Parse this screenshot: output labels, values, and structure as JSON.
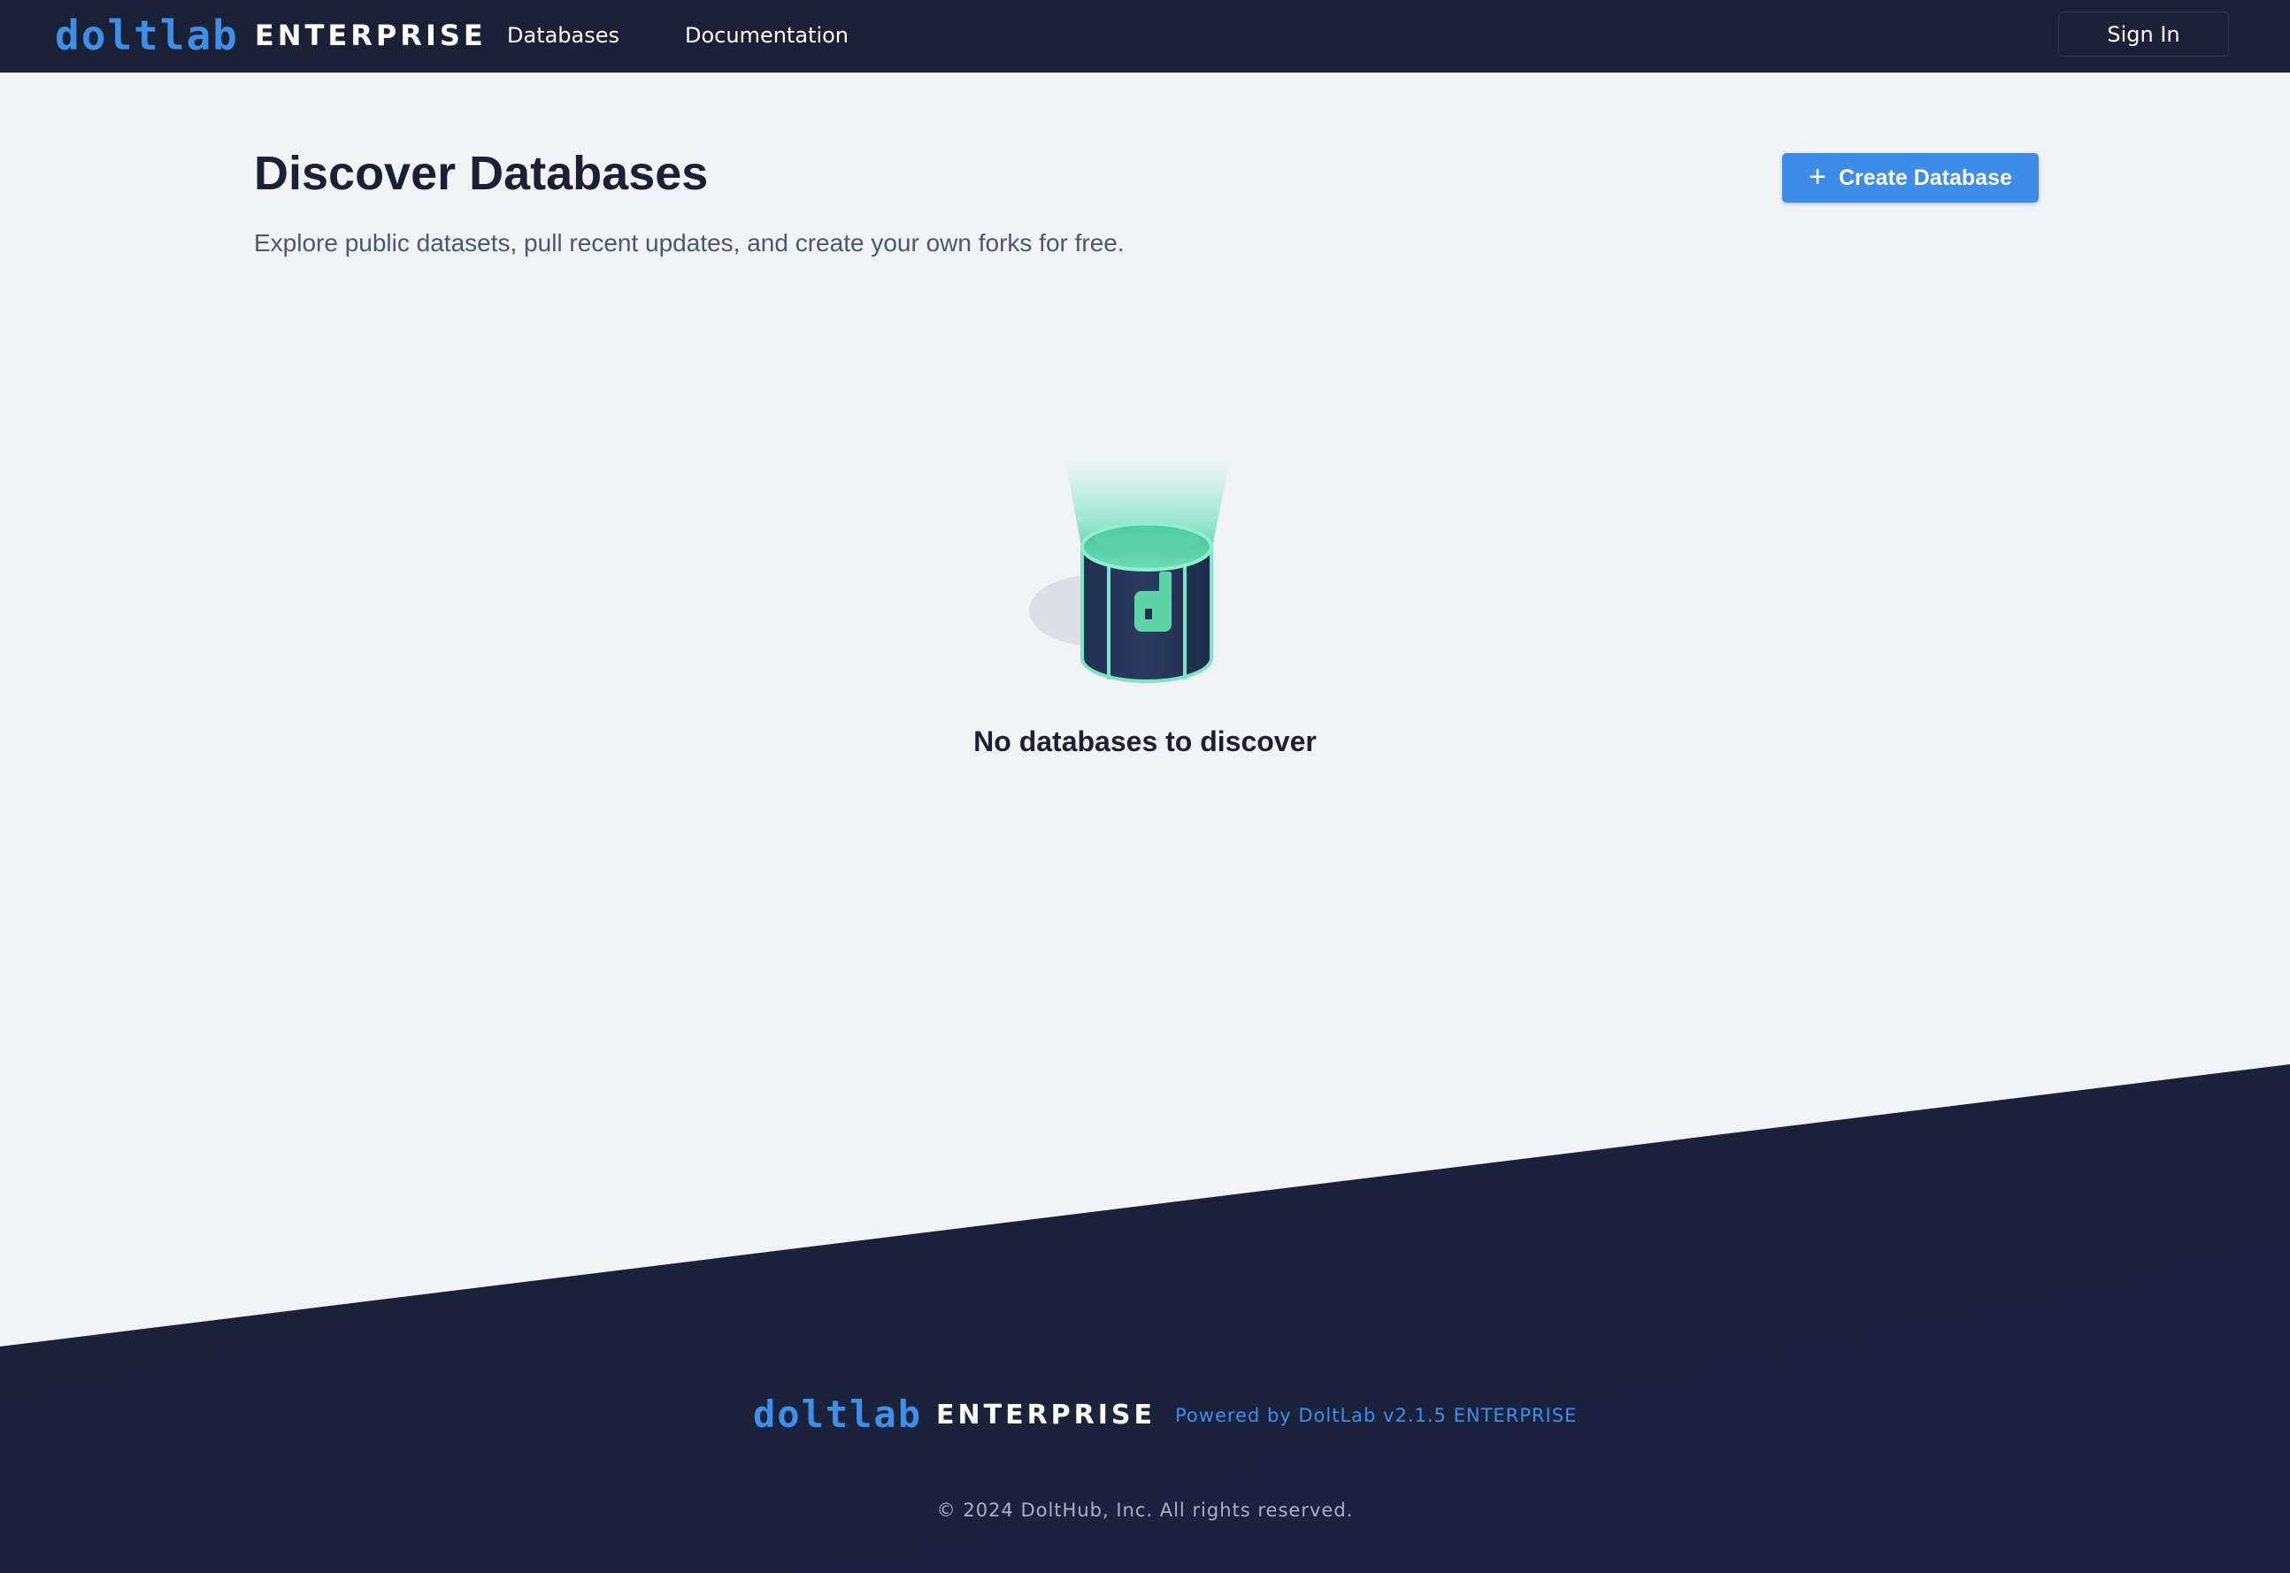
{
  "header": {
    "logo_wordmark": "doltlab",
    "logo_edition": "ENTERPRISE",
    "nav": [
      {
        "label": "Databases"
      },
      {
        "label": "Documentation"
      }
    ],
    "signin_label": "Sign In"
  },
  "main": {
    "title": "Discover Databases",
    "subtitle": "Explore public datasets, pull recent updates, and create your own forks for free.",
    "create_button_label": "Create Database",
    "create_button_icon": "plus-icon",
    "empty_state": {
      "icon": "database-icon",
      "icon_letter": "d",
      "text": "No databases to discover"
    }
  },
  "footer": {
    "logo_wordmark": "doltlab",
    "logo_edition": "ENTERPRISE",
    "powered_by": "Powered by DoltLab v2.1.5 ENTERPRISE",
    "copyright": "© 2024 DoltHub, Inc. All rights reserved."
  },
  "colors": {
    "navy": "#1a2036",
    "brand_blue": "#3f8ee8",
    "button_blue": "#3d8ce8",
    "background": "#f1f3f7",
    "teal": "#5dd4a8"
  }
}
